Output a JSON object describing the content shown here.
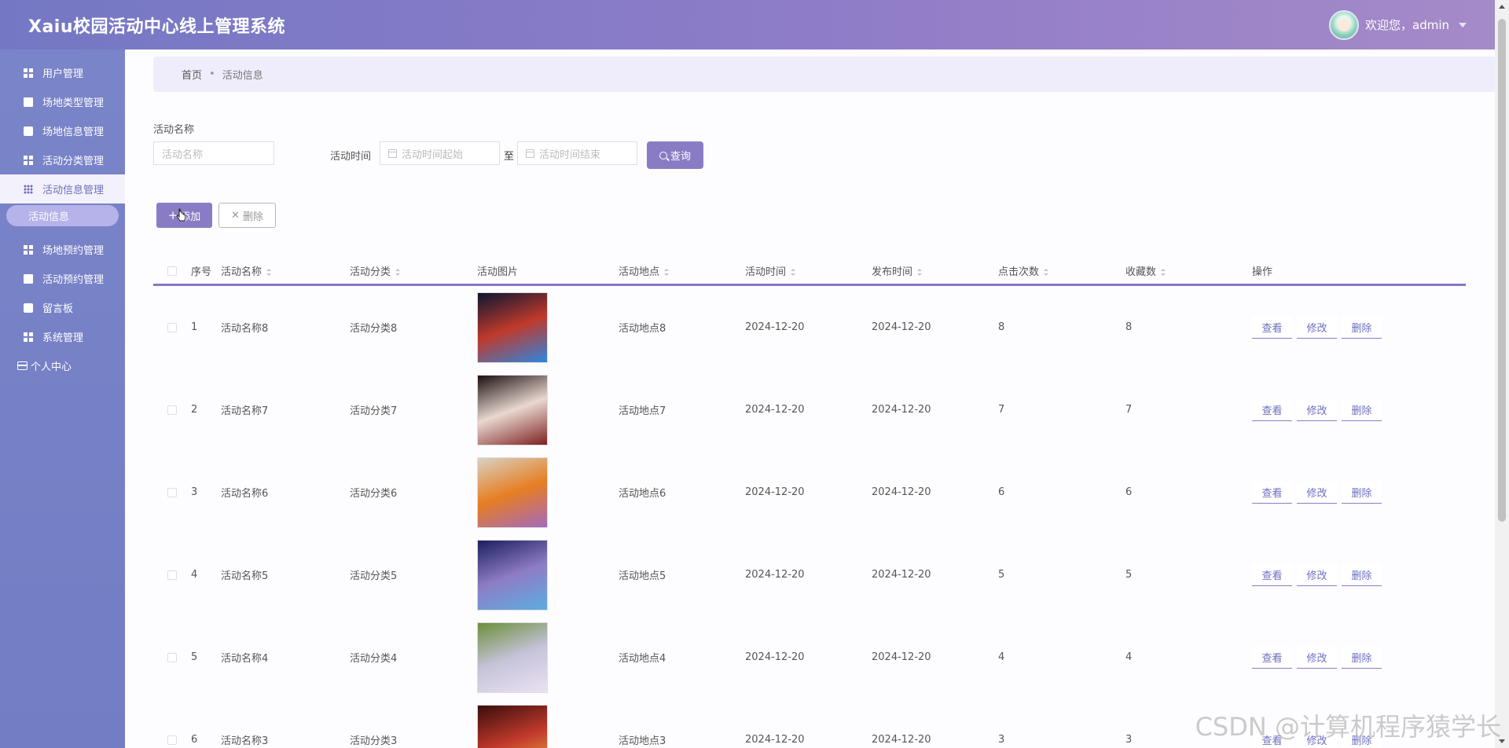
{
  "header": {
    "title": "Xaiu校园活动中心线上管理系统",
    "welcome": "欢迎您，admin"
  },
  "sidebar": {
    "items": [
      {
        "label": "用户管理",
        "icon": "grid-icon"
      },
      {
        "label": "场地类型管理",
        "icon": "clipboard-icon"
      },
      {
        "label": "场地信息管理",
        "icon": "chat-icon"
      },
      {
        "label": "活动分类管理",
        "icon": "grid-icon"
      },
      {
        "label": "活动信息管理",
        "icon": "grid-dots-icon",
        "active": true
      },
      {
        "label": "场地预约管理",
        "icon": "grid-icon"
      },
      {
        "label": "活动预约管理",
        "icon": "clipboard-icon"
      },
      {
        "label": "留言板",
        "icon": "board-icon"
      },
      {
        "label": "系统管理",
        "icon": "grid-icon"
      }
    ],
    "sub_item": "活动信息",
    "personal": "个人中心"
  },
  "breadcrumb": {
    "home": "首页",
    "current": "活动信息"
  },
  "search": {
    "name_label": "活动名称",
    "name_placeholder": "活动名称",
    "time_label": "活动时间",
    "start_placeholder": "活动时间起始",
    "to": "至",
    "end_placeholder": "活动时间结束",
    "query_label": "查询"
  },
  "toolbar": {
    "add_label": "添加",
    "delete_label": "删除"
  },
  "table": {
    "headers": [
      "序号",
      "活动名称",
      "活动分类",
      "活动图片",
      "活动地点",
      "活动时间",
      "发布时间",
      "点击次数",
      "收藏数",
      "操作"
    ],
    "ops": [
      "查看",
      "修改",
      "删除"
    ],
    "rows": [
      {
        "idx": "1",
        "name": "活动名称8",
        "cat": "活动分类8",
        "loc": "活动地点8",
        "time": "2024-12-20",
        "pub": "2024-12-20",
        "clicks": "8",
        "favs": "8"
      },
      {
        "idx": "2",
        "name": "活动名称7",
        "cat": "活动分类7",
        "loc": "活动地点7",
        "time": "2024-12-20",
        "pub": "2024-12-20",
        "clicks": "7",
        "favs": "7"
      },
      {
        "idx": "3",
        "name": "活动名称6",
        "cat": "活动分类6",
        "loc": "活动地点6",
        "time": "2024-12-20",
        "pub": "2024-12-20",
        "clicks": "6",
        "favs": "6"
      },
      {
        "idx": "4",
        "name": "活动名称5",
        "cat": "活动分类5",
        "loc": "活动地点5",
        "time": "2024-12-20",
        "pub": "2024-12-20",
        "clicks": "5",
        "favs": "5"
      },
      {
        "idx": "5",
        "name": "活动名称4",
        "cat": "活动分类4",
        "loc": "活动地点4",
        "time": "2024-12-20",
        "pub": "2024-12-20",
        "clicks": "4",
        "favs": "4"
      },
      {
        "idx": "6",
        "name": "活动名称3",
        "cat": "活动分类3",
        "loc": "活动地点3",
        "time": "2024-12-20",
        "pub": "2024-12-20",
        "clicks": "3",
        "favs": "3"
      }
    ]
  },
  "watermark": "CSDN @计算机程序猿学长",
  "colors": {
    "accent": "#8a7cc4",
    "sidebar": "#7a84c9",
    "header_start": "#7478c4",
    "header_end": "#a58ac8"
  }
}
